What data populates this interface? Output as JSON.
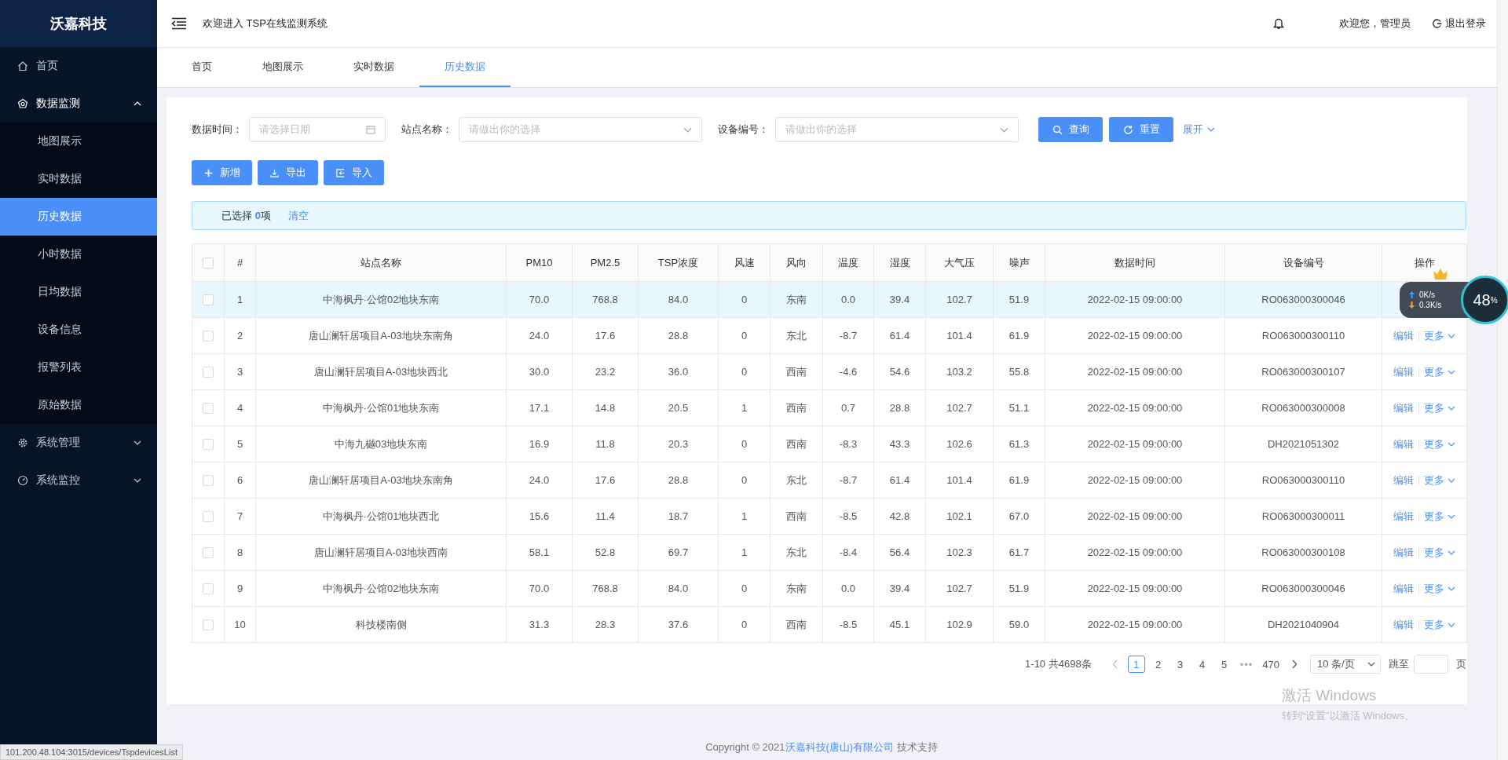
{
  "sidebar": {
    "logo": "沃嘉科技",
    "items": [
      {
        "label": "首页",
        "kind": "home",
        "selected": false
      },
      {
        "label": "数据监测",
        "kind": "monitor",
        "selected": false,
        "expanded": true,
        "children": [
          {
            "label": "地图展示",
            "selected": false
          },
          {
            "label": "实时数据",
            "selected": false
          },
          {
            "label": "历史数据",
            "selected": true
          },
          {
            "label": "小时数据",
            "selected": false
          },
          {
            "label": "日均数据",
            "selected": false
          },
          {
            "label": "设备信息",
            "selected": false
          },
          {
            "label": "报警列表",
            "selected": false
          },
          {
            "label": "原始数据",
            "selected": false
          }
        ]
      },
      {
        "label": "系统管理",
        "kind": "gear",
        "selected": false,
        "expanded": false
      },
      {
        "label": "系统监控",
        "kind": "gauge",
        "selected": false,
        "expanded": false
      }
    ]
  },
  "header": {
    "welcome": "欢迎进入 TSP在线监测系统",
    "user": "欢迎您，管理员",
    "logout": "退出登录"
  },
  "tabs": [
    {
      "label": "首页",
      "selected": false
    },
    {
      "label": "地图展示",
      "selected": false
    },
    {
      "label": "实时数据",
      "selected": false
    },
    {
      "label": "历史数据",
      "selected": true
    }
  ],
  "filters": [
    {
      "label": "数据时间：",
      "placeholder": "请选择日期",
      "kind": "date"
    },
    {
      "label": "站点名称：",
      "placeholder": "请做出你的选择",
      "kind": "select"
    },
    {
      "label": "设备编号：",
      "placeholder": "请做出你的选择",
      "kind": "select"
    }
  ],
  "search_buttons": [
    {
      "label": "查询",
      "kind": "search"
    },
    {
      "label": "重置",
      "kind": "reset"
    }
  ],
  "expand_link": "展开",
  "actions": [
    {
      "label": "新增",
      "kind": "add"
    },
    {
      "label": "导出",
      "kind": "export"
    },
    {
      "label": "导入",
      "kind": "import"
    }
  ],
  "selection": {
    "text": "已选择 **0**项",
    "clear": "清空"
  },
  "table": {
    "select_all_checked": false,
    "columns": [
      "#",
      "站点名称",
      "PM10",
      "PM2.5",
      "TSP浓度",
      "风速",
      "风向",
      "温度",
      "湿度",
      "大气压",
      "噪声",
      "数据时间",
      "设备编号",
      "操作"
    ],
    "rows": [
      {
        "checked": false,
        "highlighted": true,
        "cells": [
          "1",
          "中海枫丹·公馆02地块东南",
          "70.0",
          "768.8",
          "84.0",
          "0",
          "东南",
          "0.0",
          "39.4",
          "102.7",
          "51.9",
          "2022-02-15 09:00:00",
          "RO063000300046"
        ]
      },
      {
        "checked": false,
        "highlighted": false,
        "cells": [
          "2",
          "唐山澜轩居项目A-03地块东南角",
          "24.0",
          "17.6",
          "28.8",
          "0",
          "东北",
          "-8.7",
          "61.4",
          "101.4",
          "61.9",
          "2022-02-15 09:00:00",
          "RO063000300110"
        ],
        "edit": "编辑",
        "more": "更多"
      },
      {
        "checked": false,
        "highlighted": false,
        "cells": [
          "3",
          "唐山澜轩居项目A-03地块西北",
          "30.0",
          "23.2",
          "36.0",
          "0",
          "西南",
          "-4.6",
          "54.6",
          "103.2",
          "55.8",
          "2022-02-15 09:00:00",
          "RO063000300107"
        ],
        "edit": "编辑",
        "more": "更多"
      },
      {
        "checked": false,
        "highlighted": false,
        "cells": [
          "4",
          "中海枫丹·公馆01地块东南",
          "17.1",
          "14.8",
          "20.5",
          "1",
          "西南",
          "0.7",
          "28.8",
          "102.7",
          "51.1",
          "2022-02-15 09:00:00",
          "RO063000300008"
        ],
        "edit": "编辑",
        "more": "更多"
      },
      {
        "checked": false,
        "highlighted": false,
        "cells": [
          "5",
          "中海九樾03地块东南",
          "16.9",
          "11.8",
          "20.3",
          "0",
          "西南",
          "-8.3",
          "43.3",
          "102.6",
          "61.3",
          "2022-02-15 09:00:00",
          "DH2021051302"
        ],
        "edit": "编辑",
        "more": "更多"
      },
      {
        "checked": false,
        "highlighted": false,
        "cells": [
          "6",
          "唐山澜轩居项目A-03地块东南角",
          "24.0",
          "17.6",
          "28.8",
          "0",
          "东北",
          "-8.7",
          "61.4",
          "101.4",
          "61.9",
          "2022-02-15 09:00:00",
          "RO063000300110"
        ],
        "edit": "编辑",
        "more": "更多"
      },
      {
        "checked": false,
        "highlighted": false,
        "cells": [
          "7",
          "中海枫丹·公馆01地块西北",
          "15.6",
          "11.4",
          "18.7",
          "1",
          "西南",
          "-8.5",
          "42.8",
          "102.1",
          "67.0",
          "2022-02-15 09:00:00",
          "RO063000300011"
        ],
        "edit": "编辑",
        "more": "更多"
      },
      {
        "checked": false,
        "highlighted": false,
        "cells": [
          "8",
          "唐山澜轩居项目A-03地块西南",
          "58.1",
          "52.8",
          "69.7",
          "1",
          "东北",
          "-8.4",
          "56.4",
          "102.3",
          "61.7",
          "2022-02-15 09:00:00",
          "RO063000300108"
        ],
        "edit": "编辑",
        "more": "更多"
      },
      {
        "checked": false,
        "highlighted": false,
        "cells": [
          "9",
          "中海枫丹·公馆02地块东南",
          "70.0",
          "768.8",
          "84.0",
          "0",
          "东南",
          "0.0",
          "39.4",
          "102.7",
          "51.9",
          "2022-02-15 09:00:00",
          "RO063000300046"
        ],
        "edit": "编辑",
        "more": "更多"
      },
      {
        "checked": false,
        "highlighted": false,
        "cells": [
          "10",
          "科技楼南侧",
          "31.3",
          "28.3",
          "37.6",
          "0",
          "西南",
          "-8.5",
          "45.1",
          "102.9",
          "59.0",
          "2022-02-15 09:00:00",
          "DH2021040904"
        ],
        "edit": "编辑",
        "more": "更多"
      }
    ]
  },
  "pagination": {
    "summary": "1-10 共4698条",
    "pages": [
      {
        "label": "1",
        "kind": "page",
        "selected": true
      },
      {
        "label": "2",
        "kind": "page",
        "selected": false
      },
      {
        "label": "3",
        "kind": "page",
        "selected": false
      },
      {
        "label": "4",
        "kind": "page",
        "selected": false
      },
      {
        "label": "5",
        "kind": "page",
        "selected": false
      },
      {
        "label": "•••",
        "kind": "ellipsis",
        "selected": false
      },
      {
        "label": "470",
        "kind": "page",
        "selected": false
      }
    ],
    "page_size": "10 条/页",
    "jump_label": "跳至",
    "page_suffix": "页"
  },
  "footer": {
    "text": "Copyright © 2021",
    "company": "沃嘉科技(唐山)有限公司",
    "suffix": "技术支持"
  },
  "status_url": "101.200.48.104:3015/devices/TspdevicesList",
  "speed_widget": {
    "upload": "0K/s",
    "download": "0.3K/s",
    "percent": "48",
    "unit": "%"
  },
  "os_notice": {
    "title": "激活 Windows",
    "text": "转到“设置”以激活 Windows。"
  }
}
